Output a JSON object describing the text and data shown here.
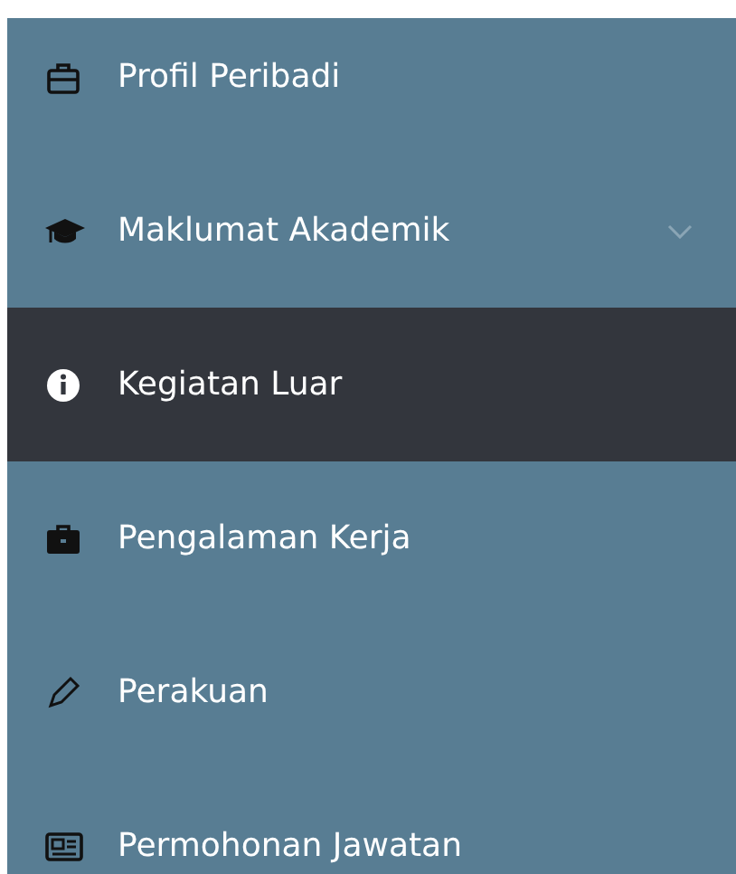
{
  "sidebar": {
    "items": [
      {
        "label": "Profil Peribadi",
        "kind": "link",
        "selected": false
      },
      {
        "label": "Maklumat Akademik",
        "kind": "dropdown",
        "selected": false
      },
      {
        "label": "Kegiatan Luar",
        "kind": "link",
        "selected": true
      },
      {
        "label": "Pengalaman Kerja",
        "kind": "link",
        "selected": false
      },
      {
        "label": "Perakuan",
        "kind": "link",
        "selected": false
      },
      {
        "label": "Permohonan Jawatan",
        "kind": "link",
        "selected": false
      }
    ]
  }
}
